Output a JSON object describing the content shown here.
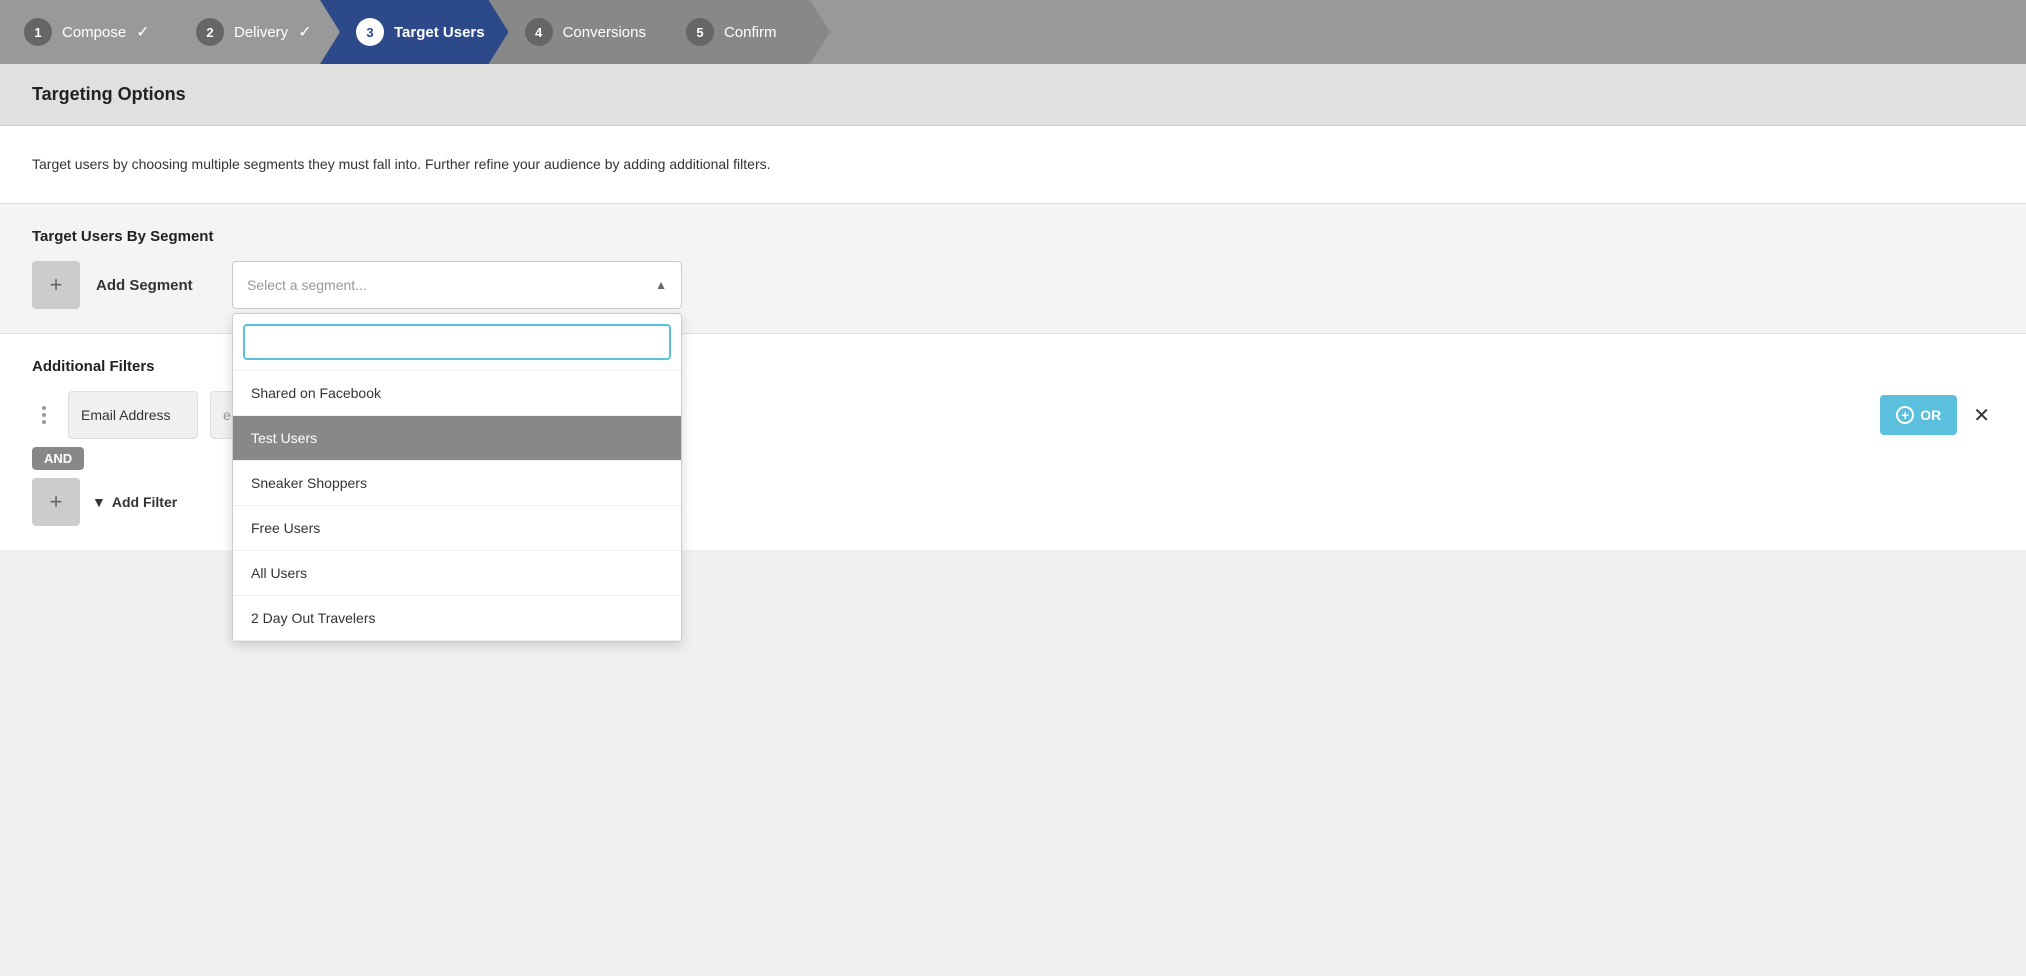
{
  "wizard": {
    "steps": [
      {
        "number": "1",
        "label": "Compose",
        "state": "completed",
        "showCheck": true
      },
      {
        "number": "2",
        "label": "Delivery",
        "state": "completed",
        "showCheck": true
      },
      {
        "number": "3",
        "label": "Target Users",
        "state": "active",
        "showCheck": false
      },
      {
        "number": "4",
        "label": "Conversions",
        "state": "inactive",
        "showCheck": false
      },
      {
        "number": "5",
        "label": "Confirm",
        "state": "inactive",
        "showCheck": false
      }
    ]
  },
  "section_header": {
    "title": "Targeting Options"
  },
  "description": {
    "text": "Target users by choosing multiple segments they must fall into. Further refine your audience by adding additional filters."
  },
  "segment_section": {
    "title": "Target Users By Segment",
    "add_button_label": "+",
    "add_segment_label": "Add Segment",
    "select_placeholder": "Select a segment...",
    "dropdown_items": [
      {
        "label": "Shared on Facebook",
        "selected": false
      },
      {
        "label": "Test Users",
        "selected": true
      },
      {
        "label": "Sneaker Shoppers",
        "selected": false
      },
      {
        "label": "Free Users",
        "selected": false
      },
      {
        "label": "All Users",
        "selected": false
      },
      {
        "label": "2 Day Out Travelers",
        "selected": false
      }
    ]
  },
  "filters_section": {
    "title": "Additional Filters",
    "filters": [
      {
        "label": "Email Address",
        "operator": "e",
        "or_button_label": "OR",
        "show_remove": true
      }
    ],
    "and_connector_label": "AND",
    "add_filter_label": "Add Filter"
  }
}
